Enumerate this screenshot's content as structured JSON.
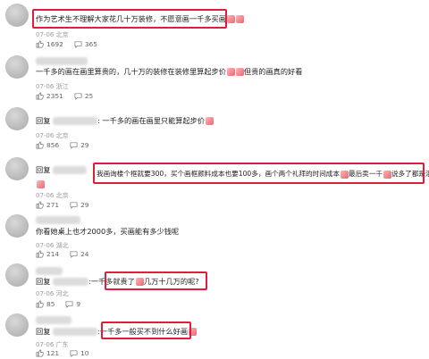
{
  "comments": [
    {
      "user": "",
      "text": "作为艺术生不理解大家花几十万装修，不愿意画一千多买画",
      "date": "07-06",
      "location": "北京",
      "likes": "1692",
      "replies": "365"
    },
    {
      "user": "",
      "text": "一千多的画在画里算贵的，几十万的装修在装修里算起步价",
      "text2": "但贵的画真的好看",
      "date": "07-06",
      "location": "浙江",
      "likes": "2351",
      "replies": "25"
    },
    {
      "user": "回复",
      "text": "一千多的画在画里只能算起步价",
      "date": "07-06",
      "location": "北京",
      "likes": "856",
      "replies": "29"
    },
    {
      "user": "回复",
      "text": "我画询楼个框就要300，买个画框颜料成本也要100多，画个两个礼拜的时间成本",
      "text2": "最后卖一千",
      "text3": "说多了都是泪",
      "date": "07-06",
      "location": "北京",
      "likes": "271",
      "replies": "29"
    },
    {
      "user": "",
      "text": "你看她桌上也才2000多，买画能有多少钱呢",
      "date": "07-06",
      "location": "湖北",
      "likes": "214",
      "replies": "24"
    },
    {
      "user": "回复",
      "text": "一千多就贵了",
      "text2": "几万十几万的呢?",
      "date": "07-06",
      "location": "河北",
      "likes": "85",
      "replies": "9"
    },
    {
      "user": "回复",
      "text": "一千多一般买不到什么好画",
      "date": "07-06",
      "location": "广东",
      "likes": "121",
      "replies": "10"
    }
  ]
}
